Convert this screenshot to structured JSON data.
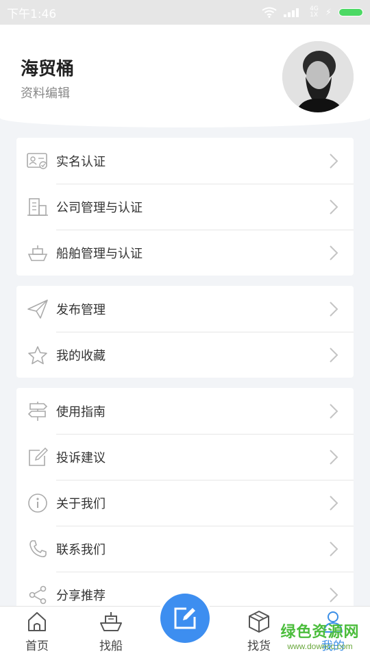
{
  "status_bar": {
    "time": "下午1:46",
    "network": "4G",
    "network2": "1X"
  },
  "profile": {
    "name": "海贸桶",
    "edit_label": "资料编辑"
  },
  "groups": [
    {
      "items": [
        {
          "label": "实名认证",
          "icon": "id-card-icon"
        },
        {
          "label": "公司管理与认证",
          "icon": "building-icon"
        },
        {
          "label": "船舶管理与认证",
          "icon": "ship-icon"
        }
      ]
    },
    {
      "items": [
        {
          "label": "发布管理",
          "icon": "paper-plane-icon"
        },
        {
          "label": "我的收藏",
          "icon": "star-icon"
        }
      ]
    },
    {
      "items": [
        {
          "label": "使用指南",
          "icon": "signpost-icon"
        },
        {
          "label": "投诉建议",
          "icon": "edit-note-icon"
        },
        {
          "label": "关于我们",
          "icon": "info-icon"
        },
        {
          "label": "联系我们",
          "icon": "phone-icon"
        },
        {
          "label": "分享推荐",
          "icon": "share-icon"
        }
      ]
    }
  ],
  "tabbar": {
    "tabs": [
      {
        "label": "首页",
        "icon": "home-icon"
      },
      {
        "label": "找船",
        "icon": "ship-icon"
      },
      {
        "label": "找货",
        "icon": "box-icon"
      },
      {
        "label": "我的",
        "icon": "user-icon",
        "active": true
      }
    ],
    "fab_icon": "compose-icon"
  },
  "watermark": {
    "title": "绿色资源网",
    "url": "www.downcc.com"
  },
  "colors": {
    "accent": "#3d8ef0",
    "active_tab": "#3a8ee6",
    "background": "#f2f4f7"
  }
}
